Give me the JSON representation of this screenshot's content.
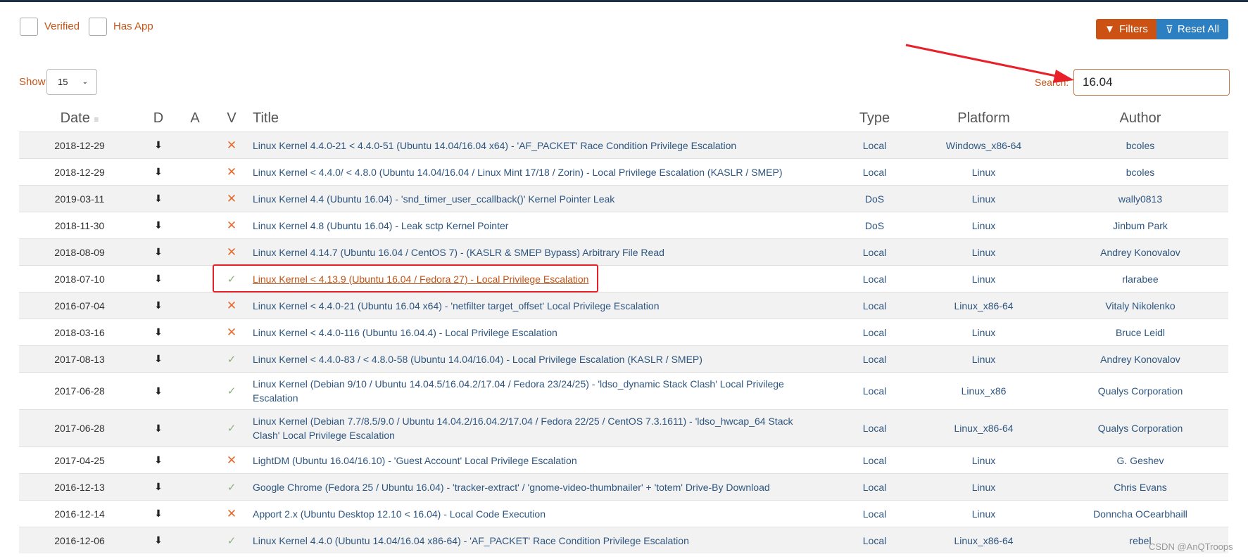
{
  "filters": {
    "verified_label": "Verified",
    "has_app_label": "Has App"
  },
  "buttons": {
    "filters_label": "Filters",
    "reset_label": "Reset All"
  },
  "show": {
    "label": "Show",
    "value": "15"
  },
  "search": {
    "label": "Search:",
    "value": "16.04"
  },
  "columns": [
    "Date",
    "D",
    "A",
    "V",
    "Title",
    "Type",
    "Platform",
    "Author"
  ],
  "colors": {
    "accent_orange": "#cc5214",
    "accent_blue": "#2c7fc0",
    "link": "#2e557f",
    "annotation_red": "#e8202a"
  },
  "rows": [
    {
      "date": "2018-12-29",
      "verified": false,
      "title": "Linux Kernel 4.4.0-21 < 4.4.0-51 (Ubuntu 14.04/16.04 x64) - 'AF_PACKET' Race Condition Privilege Escalation",
      "type": "Local",
      "platform": "Windows_x86-64",
      "author": "bcoles"
    },
    {
      "date": "2018-12-29",
      "verified": false,
      "title": "Linux Kernel < 4.4.0/ < 4.8.0 (Ubuntu 14.04/16.04 / Linux Mint 17/18 / Zorin) - Local Privilege Escalation (KASLR / SMEP)",
      "type": "Local",
      "platform": "Linux",
      "author": "bcoles"
    },
    {
      "date": "2019-03-11",
      "verified": false,
      "title": "Linux Kernel 4.4 (Ubuntu 16.04) - 'snd_timer_user_ccallback()' Kernel Pointer Leak",
      "type": "DoS",
      "platform": "Linux",
      "author": "wally0813"
    },
    {
      "date": "2018-11-30",
      "verified": false,
      "title": "Linux Kernel 4.8 (Ubuntu 16.04) - Leak sctp Kernel Pointer",
      "type": "DoS",
      "platform": "Linux",
      "author": "Jinbum Park"
    },
    {
      "date": "2018-08-09",
      "verified": false,
      "title": "Linux Kernel 4.14.7 (Ubuntu 16.04 / CentOS 7) - (KASLR & SMEP Bypass) Arbitrary File Read",
      "type": "Local",
      "platform": "Linux",
      "author": "Andrey Konovalov"
    },
    {
      "date": "2018-07-10",
      "verified": true,
      "highlight": true,
      "title": "Linux Kernel < 4.13.9 (Ubuntu 16.04 / Fedora 27) - Local Privilege Escalation",
      "type": "Local",
      "platform": "Linux",
      "author": "rlarabee"
    },
    {
      "date": "2016-07-04",
      "verified": false,
      "title": "Linux Kernel < 4.4.0-21 (Ubuntu 16.04 x64) - 'netfilter target_offset' Local Privilege Escalation",
      "type": "Local",
      "platform": "Linux_x86-64",
      "author": "Vitaly Nikolenko"
    },
    {
      "date": "2018-03-16",
      "verified": false,
      "title": "Linux Kernel < 4.4.0-116 (Ubuntu 16.04.4) - Local Privilege Escalation",
      "type": "Local",
      "platform": "Linux",
      "author": "Bruce Leidl"
    },
    {
      "date": "2017-08-13",
      "verified": true,
      "title": "Linux Kernel < 4.4.0-83 / < 4.8.0-58 (Ubuntu 14.04/16.04) - Local Privilege Escalation (KASLR / SMEP)",
      "type": "Local",
      "platform": "Linux",
      "author": "Andrey Konovalov"
    },
    {
      "date": "2017-06-28",
      "verified": true,
      "two": true,
      "title": "Linux Kernel (Debian 9/10 / Ubuntu 14.04.5/16.04.2/17.04 / Fedora 23/24/25) - 'ldso_dynamic Stack Clash' Local Privilege Escalation",
      "type": "Local",
      "platform": "Linux_x86",
      "author": "Qualys Corporation"
    },
    {
      "date": "2017-06-28",
      "verified": true,
      "two": true,
      "title": "Linux Kernel (Debian 7.7/8.5/9.0 / Ubuntu 14.04.2/16.04.2/17.04 / Fedora 22/25 / CentOS 7.3.1611) - 'ldso_hwcap_64 Stack Clash' Local Privilege Escalation",
      "type": "Local",
      "platform": "Linux_x86-64",
      "author": "Qualys Corporation"
    },
    {
      "date": "2017-04-25",
      "verified": false,
      "title": "LightDM (Ubuntu 16.04/16.10) - 'Guest Account' Local Privilege Escalation",
      "type": "Local",
      "platform": "Linux",
      "author": "G. Geshev"
    },
    {
      "date": "2016-12-13",
      "verified": true,
      "title": "Google Chrome (Fedora 25 / Ubuntu 16.04) - 'tracker-extract' / 'gnome-video-thumbnailer' + 'totem' Drive-By Download",
      "type": "Local",
      "platform": "Linux",
      "author": "Chris Evans"
    },
    {
      "date": "2016-12-14",
      "verified": false,
      "title": "Apport 2.x (Ubuntu Desktop 12.10 < 16.04) - Local Code Execution",
      "type": "Local",
      "platform": "Linux",
      "author": "Donncha OCearbhaill"
    },
    {
      "date": "2016-12-06",
      "verified": true,
      "title": "Linux Kernel 4.4.0 (Ubuntu 14.04/16.04 x86-64) - 'AF_PACKET' Race Condition Privilege Escalation",
      "type": "Local",
      "platform": "Linux_x86-64",
      "author": "rebel"
    }
  ],
  "watermark": "CSDN @AnQTroops"
}
